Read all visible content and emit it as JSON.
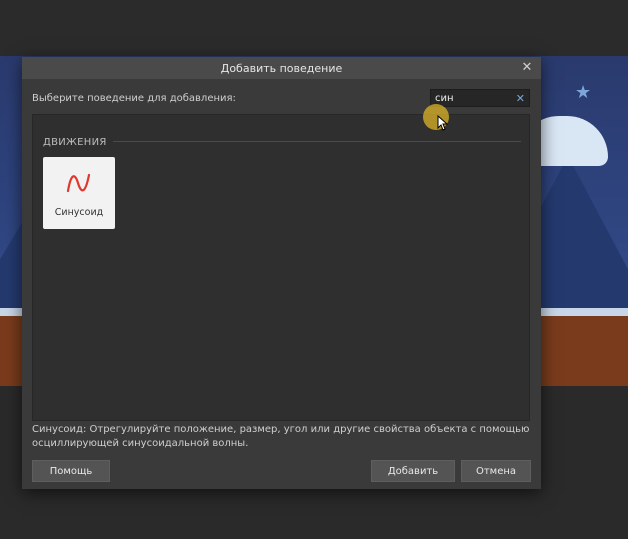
{
  "dialog": {
    "title": "Добавить поведение",
    "prompt": "Выберите поведение для добавления:",
    "search": {
      "value": "син"
    },
    "section": {
      "title": "ДВИЖЕНИЯ"
    },
    "behaviors": [
      {
        "label": "Синусоид",
        "icon": "sine-wave-icon"
      }
    ],
    "description": "Синусоид: Отрегулируйте положение, размер, угол или другие свойства объекта с помощью осциллирующей синусоидальной волны.",
    "buttons": {
      "help": "Помощь",
      "add": "Добавить",
      "cancel": "Отмена"
    }
  },
  "colors": {
    "accent_icon": "#e0382d",
    "cursor_highlight": "#dcb428"
  }
}
